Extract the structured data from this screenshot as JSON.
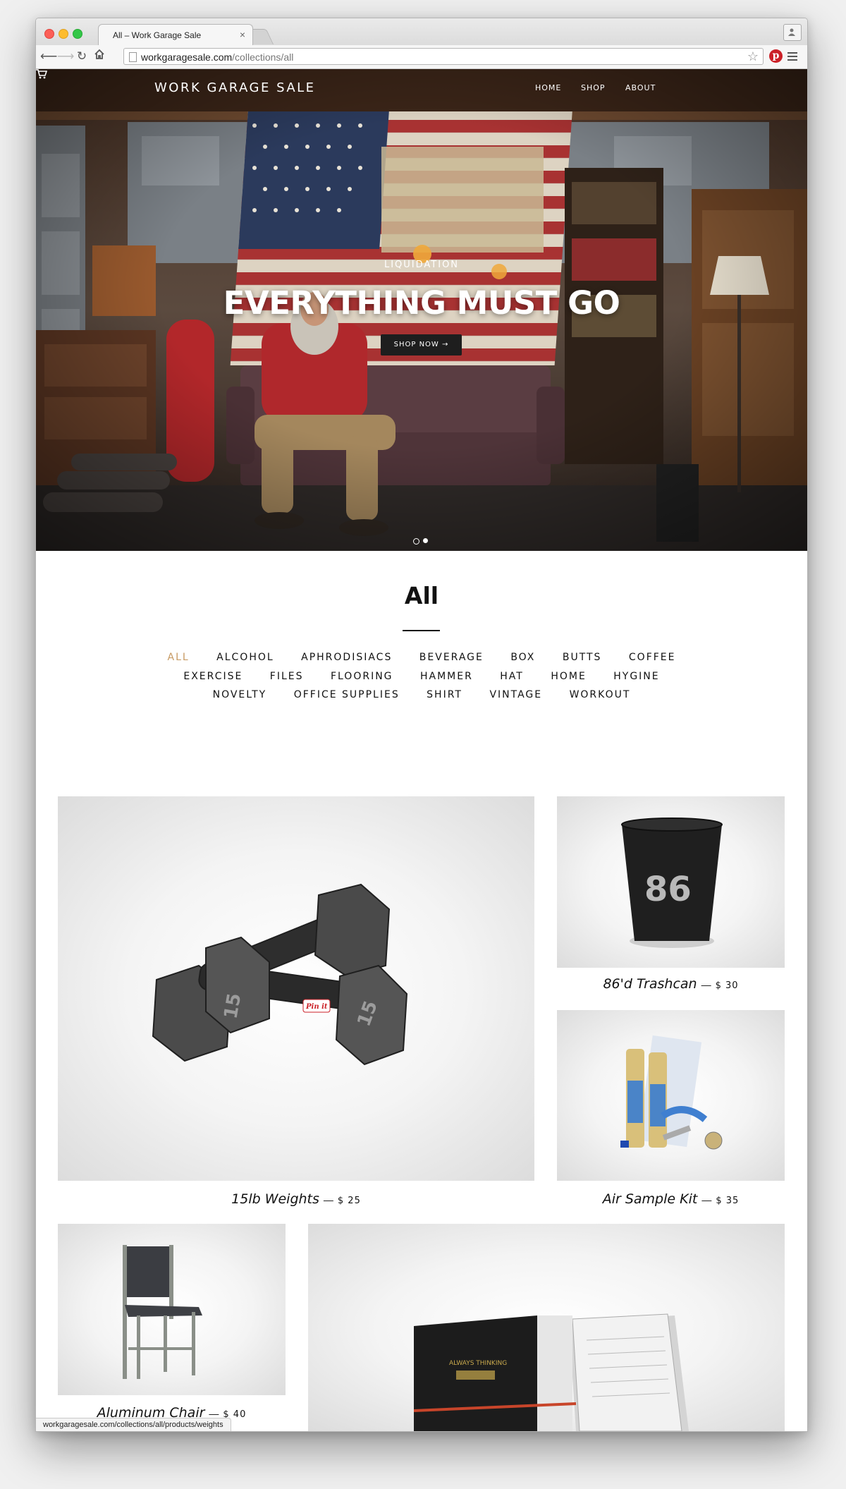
{
  "browser": {
    "tab_title": "All – Work Garage Sale",
    "url_domain": "workgaragesale.com",
    "url_path": "/collections/all",
    "status_url": "workgaragesale.com/collections/all/products/weights"
  },
  "header": {
    "site_title": "WORK GARAGE SALE",
    "nav": [
      "HOME",
      "SHOP",
      "ABOUT"
    ]
  },
  "hero": {
    "kicker": "LIQUIDATION",
    "headline": "EVERYTHING MUST GO",
    "button": "SHOP NOW →"
  },
  "collection": {
    "title": "All",
    "filters_row1": [
      "ALL",
      "ALCOHOL",
      "APHRODISIACS",
      "BEVERAGE",
      "BOX",
      "BUTTS",
      "COFFEE"
    ],
    "filters_row2": [
      "EXERCISE",
      "FILES",
      "FLOORING",
      "HAMMER",
      "HAT",
      "HOME",
      "HYGINE"
    ],
    "filters_row3": [
      "NOVELTY",
      "OFFICE SUPPLIES",
      "SHIRT",
      "VINTAGE",
      "WORKOUT"
    ],
    "active_filter": "ALL",
    "active_color": "#c79a63"
  },
  "products": [
    {
      "name": "15lb Weights",
      "sep": "—",
      "price": "$ 25",
      "badge": "Pin it"
    },
    {
      "name": "86'd Trashcan",
      "sep": "—",
      "price": "$ 30",
      "print": "86"
    },
    {
      "name": "Air Sample Kit",
      "sep": "—",
      "price": "$ 35"
    },
    {
      "name": "Aluminum Chair",
      "sep": "—",
      "price": "$ 40"
    },
    {
      "name": "",
      "price": "",
      "print": "ALWAYS THINKING"
    }
  ]
}
